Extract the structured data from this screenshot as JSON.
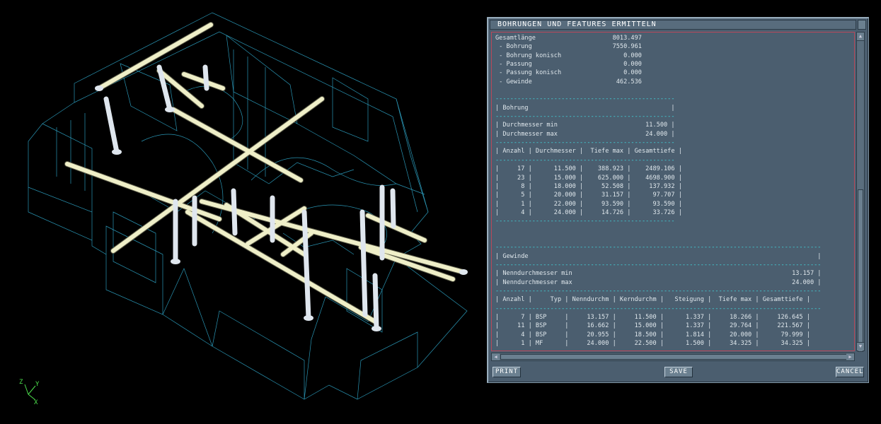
{
  "dialog": {
    "title": "BOHRUNGEN UND FEATURES ERMITTELN",
    "buttons": {
      "print": "PRINT",
      "save": "SAVE",
      "cancel": "CANCEL"
    }
  },
  "axis": {
    "x": "X",
    "y": "Y",
    "z": "Z"
  },
  "report": {
    "lines": [
      "Gesamtlänge                     8013.497",
      " - Bohrung                      7550.961",
      " - Bohrung konisch                 0.000",
      " - Passung                         0.000",
      " - Passung konisch                 0.000",
      " - Gewinde                       462.536",
      "",
      "-------------------------------------------------",
      "| Bohrung                                       |",
      "-------------------------------------------------",
      "| Durchmesser min                        11.500 |",
      "| Durchmesser max                        24.000 |",
      "-------------------------------------------------",
      "| Anzahl | Durchmesser |  Tiefe max | Gesamttiefe |",
      "-------------------------------------------------",
      "|     17 |      11.500 |    388.923 |    2489.106 |",
      "|     23 |      15.000 |    625.000 |    4698.900 |",
      "|      8 |      18.000 |     52.508 |     137.932 |",
      "|      5 |      20.000 |     31.157 |      97.707 |",
      "|      1 |      22.000 |     93.590 |      93.590 |",
      "|      4 |      24.000 |     14.726 |      33.726 |",
      "-------------------------------------------------",
      "",
      "",
      "-----------------------------------------------------------------------------------------",
      "| Gewinde                                                                               |",
      "-----------------------------------------------------------------------------------------",
      "| Nenndurchmesser min                                                            13.157 |",
      "| Nenndurchmesser max                                                            24.000 |",
      "-----------------------------------------------------------------------------------------",
      "| Anzahl |     Typ | Nenndurchm | Kerndurchm |   Steigung |  Tiefe max | Gesamttiefe |",
      "-----------------------------------------------------------------------------------------",
      "|      7 | BSP     |     13.157 |     11.500 |      1.337 |     18.266 |     126.645 |",
      "|     11 | BSP     |     16.662 |     15.000 |      1.337 |     29.764 |     221.567 |",
      "|      4 | BSP     |     20.955 |     18.500 |      1.814 |     20.000 |      79.999 |",
      "|      1 | MF      |     24.000 |     22.500 |      1.500 |     34.325 |      34.325 |",
      "-----------------------------------------------------------------------------------------"
    ]
  }
}
